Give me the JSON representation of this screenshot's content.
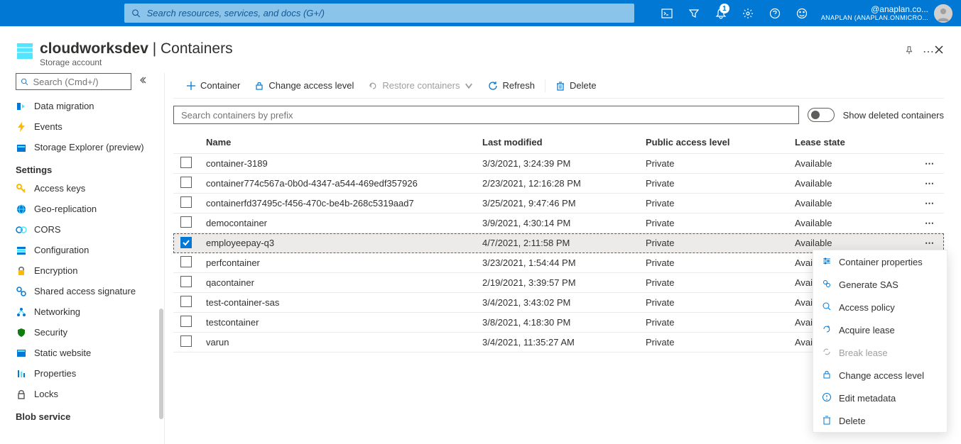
{
  "topbar": {
    "search_placeholder": "Search resources, services, and docs (G+/)",
    "notif_count": "1",
    "user_email": "@anaplan.co...",
    "user_tenant": "ANAPLAN (ANAPLAN.ONMICRO..."
  },
  "header": {
    "resource_name": "cloudworksdev",
    "separator": " | ",
    "section": "Containers",
    "subtitle": "Storage account"
  },
  "sidebar": {
    "search_placeholder": "Search (Cmd+/)",
    "top_items": [
      {
        "label": "Data migration",
        "icon": "data-migration"
      },
      {
        "label": "Events",
        "icon": "events"
      },
      {
        "label": "Storage Explorer (preview)",
        "icon": "storage-explorer"
      }
    ],
    "sections": [
      {
        "title": "Settings",
        "items": [
          {
            "label": "Access keys",
            "icon": "key"
          },
          {
            "label": "Geo-replication",
            "icon": "geo"
          },
          {
            "label": "CORS",
            "icon": "cors"
          },
          {
            "label": "Configuration",
            "icon": "config"
          },
          {
            "label": "Encryption",
            "icon": "lock"
          },
          {
            "label": "Shared access signature",
            "icon": "sas"
          },
          {
            "label": "Networking",
            "icon": "network"
          },
          {
            "label": "Security",
            "icon": "shield"
          },
          {
            "label": "Static website",
            "icon": "static-web"
          },
          {
            "label": "Properties",
            "icon": "properties"
          },
          {
            "label": "Locks",
            "icon": "lock2"
          }
        ]
      },
      {
        "title": "Blob service",
        "items": []
      }
    ]
  },
  "toolbar": {
    "add": "Container",
    "change_access": "Change access level",
    "restore": "Restore containers",
    "refresh": "Refresh",
    "delete": "Delete"
  },
  "filter": {
    "prefix_placeholder": "Search containers by prefix",
    "toggle_label": "Show deleted containers"
  },
  "table": {
    "columns": {
      "name": "Name",
      "modified": "Last modified",
      "access": "Public access level",
      "lease": "Lease state"
    },
    "rows": [
      {
        "name": "container-3189",
        "modified": "3/3/2021, 3:24:39 PM",
        "access": "Private",
        "lease": "Available",
        "selected": false
      },
      {
        "name": "container774c567a-0b0d-4347-a544-469edf357926",
        "modified": "2/23/2021, 12:16:28 PM",
        "access": "Private",
        "lease": "Available",
        "selected": false
      },
      {
        "name": "containerfd37495c-f456-470c-be4b-268c5319aad7",
        "modified": "3/25/2021, 9:47:46 PM",
        "access": "Private",
        "lease": "Available",
        "selected": false
      },
      {
        "name": "democontainer",
        "modified": "3/9/2021, 4:30:14 PM",
        "access": "Private",
        "lease": "Available",
        "selected": false
      },
      {
        "name": "employeepay-q3",
        "modified": "4/7/2021, 2:11:58 PM",
        "access": "Private",
        "lease": "Available",
        "selected": true
      },
      {
        "name": "perfcontainer",
        "modified": "3/23/2021, 1:54:44 PM",
        "access": "Private",
        "lease": "Available",
        "selected": false
      },
      {
        "name": "qacontainer",
        "modified": "2/19/2021, 3:39:57 PM",
        "access": "Private",
        "lease": "Available",
        "selected": false
      },
      {
        "name": "test-container-sas",
        "modified": "3/4/2021, 3:43:02 PM",
        "access": "Private",
        "lease": "Available",
        "selected": false
      },
      {
        "name": "testcontainer",
        "modified": "3/8/2021, 4:18:30 PM",
        "access": "Private",
        "lease": "Available",
        "selected": false
      },
      {
        "name": "varun",
        "modified": "3/4/2021, 11:35:27 AM",
        "access": "Private",
        "lease": "Available",
        "selected": false
      }
    ]
  },
  "context_menu": {
    "items": [
      {
        "label": "Container properties",
        "icon": "settings",
        "disabled": false
      },
      {
        "label": "Generate SAS",
        "icon": "link",
        "disabled": false
      },
      {
        "label": "Access policy",
        "icon": "search",
        "disabled": false
      },
      {
        "label": "Acquire lease",
        "icon": "lease",
        "disabled": false
      },
      {
        "label": "Break lease",
        "icon": "break-lease",
        "disabled": true
      },
      {
        "label": "Change access level",
        "icon": "lock",
        "disabled": false
      },
      {
        "label": "Edit metadata",
        "icon": "edit",
        "disabled": false
      },
      {
        "label": "Delete",
        "icon": "delete",
        "disabled": false
      }
    ]
  }
}
